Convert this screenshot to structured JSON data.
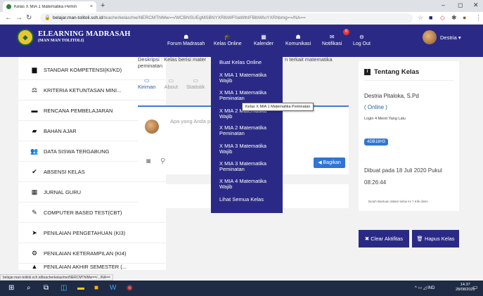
{
  "browser": {
    "tab_title": "Kelas X MIA 1 Matematika Pemin",
    "tab_close": "×",
    "new_tab": "+",
    "url_host": "belajar.man-tolitoli.sch.id",
    "url_path": "/teacherkelas/me/NERCMThlMw==/WCBNSUEgMSBNYXRlbWF0aWthIFBlbWluYXRhbmg==/NA==",
    "status_url": "belajar.man-tolitoli.sch.id/teacherkelas/me/NERCMThlMw==/.../NA=="
  },
  "app": {
    "brand": "ELEARNING MADRASAH",
    "brand_sub": "(MAN MAN TOLITOLI)",
    "nav": [
      {
        "icon": "☗",
        "label": "Forum Madrasah"
      },
      {
        "icon": "🎓",
        "label": "Kelas Online"
      },
      {
        "icon": "▦",
        "label": "Kalender"
      },
      {
        "icon": "☗",
        "label": "Komunikasi"
      },
      {
        "icon": "✉",
        "label": "Notifikasi"
      },
      {
        "icon": "⊖",
        "label": "Log Out"
      }
    ],
    "notif_count": "0",
    "user_name": "Destria ▾"
  },
  "sidebar": {
    "items": [
      {
        "icon": "▆",
        "label": "STANDAR KOMPETENSI(KI/KD)"
      },
      {
        "icon": "⚖",
        "label": "KRITERIA KETUNTASAN MINI..."
      },
      {
        "icon": "▬",
        "label": "RENCANA PEMBELAJARAN"
      },
      {
        "icon": "▰",
        "label": "BAHAN AJAR"
      },
      {
        "icon": "👥",
        "label": "DATA SISWA TERGABUNG"
      },
      {
        "icon": "✔",
        "label": "ABSENSI KELAS"
      },
      {
        "icon": "▦",
        "label": "JURNAL GURU"
      },
      {
        "icon": "✎",
        "label": "COMPUTER BASED TEST(CBT)"
      },
      {
        "icon": "➤",
        "label": "PENILAIAN PENGETAHUAN (KI3)"
      },
      {
        "icon": "⚙",
        "label": "PENILAIAN KETERAMPILAN (KI4)"
      },
      {
        "icon": "▲",
        "label": "PENILAIAN AKHIR SEMESTER (..."
      }
    ]
  },
  "main": {
    "description_1": "Deskripsi : Kelas berisi mater",
    "description_1b": "n terkait matematika",
    "description_2": "peminatan",
    "tabs": [
      {
        "icon": "▭",
        "label": "Kiriman"
      },
      {
        "icon": "▭",
        "label": "About"
      },
      {
        "icon": "▭",
        "label": "Statistik"
      }
    ],
    "post_placeholder": "Apa yang Anda p",
    "share_label": "◀ Bagikan"
  },
  "dropdown": {
    "items": [
      "Buat Kelas Online",
      "X MIA 1 Matematika Wajib",
      "X MIA 1 Matematika Peminatan",
      "X MIA 2 Matematika Wajib",
      "X MIA 2 Matematika Peminatan",
      "X MIA 3 Matematika Wajib",
      "X MIA 3 Matematika Peminatan",
      "X MIA 4 Matematika Wajib",
      "Lihat Semua Kelas"
    ],
    "tooltip": "Kelas X MIA 1 Matematika Peminatan"
  },
  "panel": {
    "title": "Tentang Kelas",
    "teacher": "Destria Pitaloka, S.Pd",
    "status": "( Online )",
    "last_login": "Login 4 Menit Yang Lalu",
    "class_code": "4DB18H3",
    "created": "Dibuat pada 18 Juli 2020 Pukul 08:26:44",
    "help": "Butuh Bantuan dalam kelas ini ? Klik disini"
  },
  "actions": {
    "clear": "✖ Clear Aktifitas",
    "delete": "🗑 Hapus Kelas"
  },
  "taskbar": {
    "tray": "^ ▭ ◿ IND",
    "time": "14.37",
    "date": "28/08/2020"
  },
  "colors": {
    "header": "#2a2a86",
    "accent_blue": "#2f75d6",
    "notif_red": "#e53935"
  }
}
